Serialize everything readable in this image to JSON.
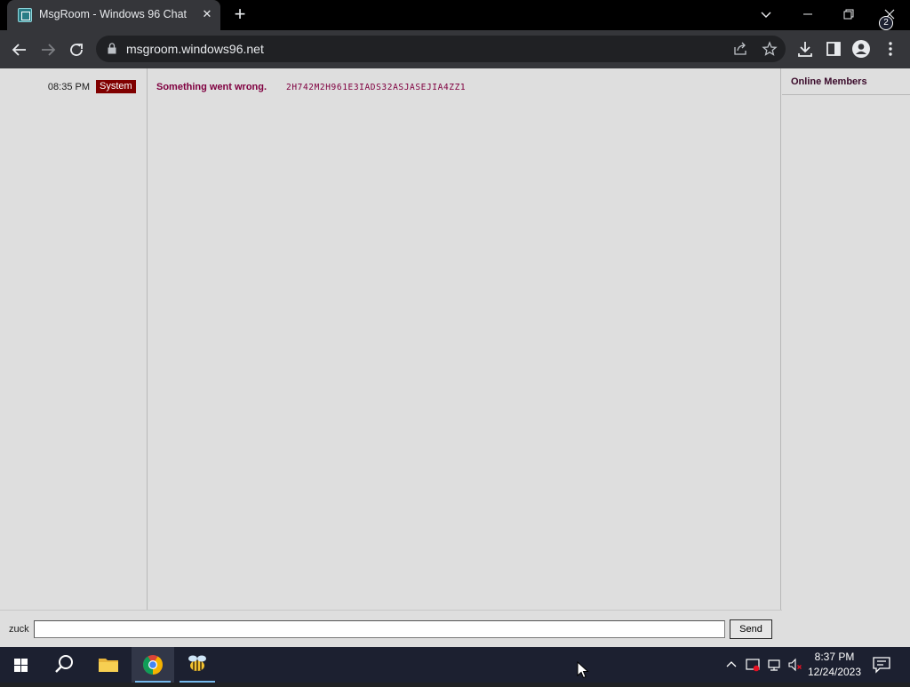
{
  "browser": {
    "tab_title": "MsgRoom - Windows 96 Chat",
    "tab_close": "✕",
    "new_tab": "+",
    "url": "msgroom.windows96.net"
  },
  "chat": {
    "messages": [
      {
        "time": "08:35 PM",
        "sender": "System",
        "text": "Something went wrong.",
        "code": "2H742M2H961E3IADS32ASJASEJIA4ZZ1"
      }
    ]
  },
  "members": {
    "title": "Online Members"
  },
  "input": {
    "nickname": "zuck",
    "value": "",
    "send_label": "Send"
  },
  "taskbar": {
    "time": "8:37 PM",
    "date": "12/24/2023",
    "notification_count": "2"
  },
  "icons": [
    "window96-favicon",
    "new-tab-icon",
    "tab-search-icon",
    "minimize-icon",
    "restore-icon",
    "close-icon",
    "back-arrow-icon",
    "forward-arrow-icon",
    "reload-icon",
    "lock-icon",
    "share-icon",
    "star-icon",
    "download-icon",
    "side-panel-icon",
    "profile-icon",
    "menu-dots-icon",
    "windows-start-icon",
    "search-icon",
    "file-explorer-icon",
    "chrome-icon",
    "bee-app-icon",
    "chevron-up-icon",
    "security-icon",
    "network-icon",
    "volume-muted-icon",
    "notification-icon"
  ],
  "colors": {
    "system_badge": "#800000",
    "message_text": "#800040",
    "page_bg": "#dedede",
    "taskbar_bg": "#1c2030"
  }
}
